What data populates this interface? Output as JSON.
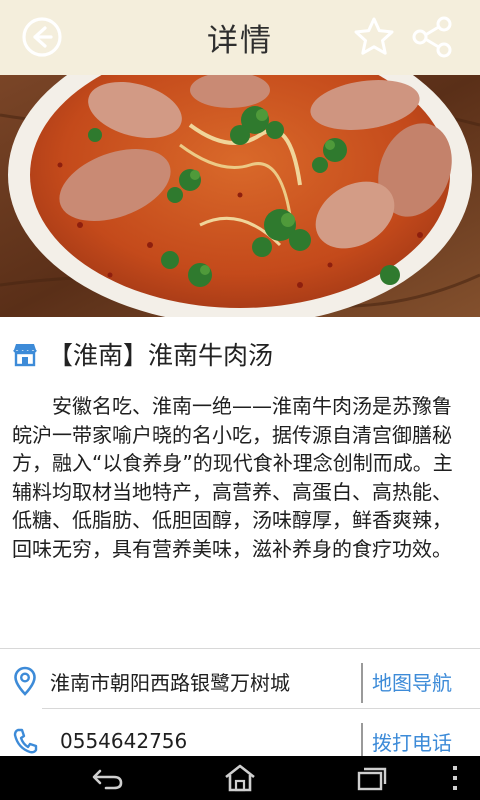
{
  "header": {
    "title": "详情",
    "back_icon": "back-arrow-circle-icon",
    "favorite_icon": "star-outline-icon",
    "share_icon": "share-icon",
    "background": "#f4eedc"
  },
  "hero": {
    "icon": "beef-soup-photo"
  },
  "dish": {
    "icon": "shop-icon",
    "title": "【淮南】淮南牛肉汤",
    "description": "安徽名吃、淮南一绝——淮南牛肉汤是苏豫鲁皖沪一带家喻户晓的名小吃，据传源自清宫御膳秘方，融入“以食养身”的现代食补理念创制而成。主辅料均取材当地特产，高营养、高蛋白、高热能、低糖、低脂肪、低胆固醇，汤味醇厚，鲜香爽辣，回味无穷，具有营养美味，滋补养身的食疗功效。"
  },
  "info": {
    "address": "淮南市朝阳西路银鹭万树城",
    "address_icon": "location-pin-icon",
    "map_action": "地图导航",
    "phone": "0554642756",
    "phone_icon": "phone-icon",
    "call_action": "拨打电话",
    "accent_color": "#3d8bd8",
    "icon_color": "#3d8bd8"
  },
  "navbar": {
    "back_icon": "nav-back-icon",
    "home_icon": "nav-home-icon",
    "recents_icon": "nav-recents-icon",
    "menu_icon": "nav-menu-icon"
  }
}
